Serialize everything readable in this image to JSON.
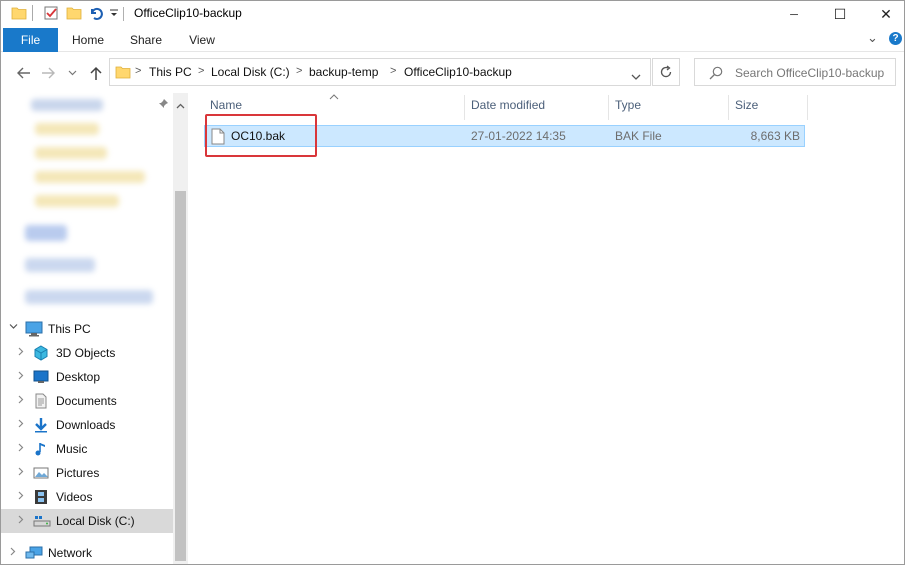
{
  "window": {
    "title": "OfficeClip10-backup",
    "controls": {
      "minimize": "─",
      "maximize": "☐",
      "close": "✕"
    }
  },
  "ribbon": {
    "tabs": [
      "File",
      "Home",
      "Share",
      "View"
    ],
    "collapse_glyph": "⌄",
    "help_glyph": "?"
  },
  "address": {
    "crumbs": [
      "This PC",
      "Local Disk (C:)",
      "backup-temp",
      "OfficeClip10-backup"
    ],
    "separator": ">"
  },
  "search": {
    "placeholder": "Search OfficeClip10-backup"
  },
  "sort_indicator": "^",
  "columns": [
    "Name",
    "Date modified",
    "Type",
    "Size"
  ],
  "files": [
    {
      "name": "OC10.bak",
      "date_modified": "27-01-2022 14:35",
      "type": "BAK File",
      "size": "8,663 KB"
    }
  ],
  "nav": {
    "this_pc": "This PC",
    "items": [
      {
        "label": "3D Objects",
        "icon": "3d-objects-icon"
      },
      {
        "label": "Desktop",
        "icon": "desktop-icon"
      },
      {
        "label": "Documents",
        "icon": "documents-icon"
      },
      {
        "label": "Downloads",
        "icon": "downloads-icon"
      },
      {
        "label": "Music",
        "icon": "music-icon"
      },
      {
        "label": "Pictures",
        "icon": "pictures-icon"
      },
      {
        "label": "Videos",
        "icon": "videos-icon"
      },
      {
        "label": "Local Disk (C:)",
        "icon": "drive-icon",
        "selected": true
      }
    ],
    "network": "Network"
  },
  "colors": {
    "accent": "#1979ca",
    "selection": "#cce8ff",
    "highlight": "#d9363a"
  }
}
